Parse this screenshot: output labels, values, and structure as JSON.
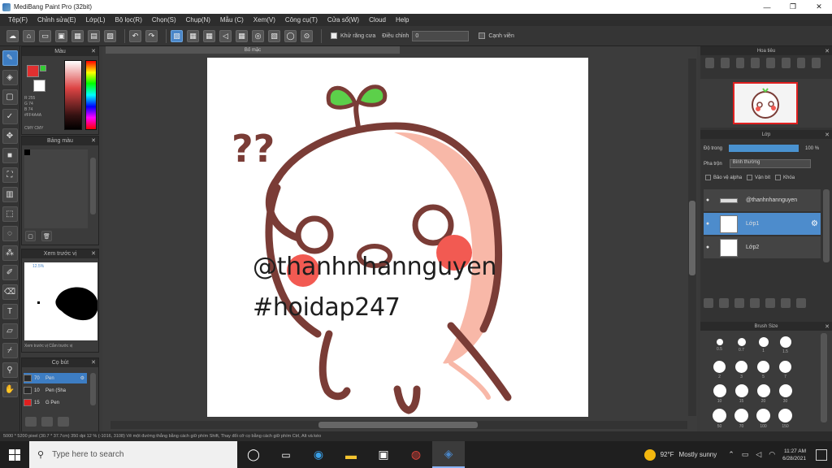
{
  "window": {
    "title": "MediBang Paint Pro (32bit)",
    "minimize": "—",
    "maximize": "❐",
    "close": "✕"
  },
  "menu": [
    "Tệp(F)",
    "Chỉnh sửa(E)",
    "Lớp(L)",
    "Bộ lọc(R)",
    "Chọn(S)",
    "Chụp(N)",
    "Mẫu (C)",
    "Xem(V)",
    "Công cụ(T)",
    "Cửa sổ(W)",
    "Cloud",
    "Help"
  ],
  "toolbar": {
    "auto_select_label": "Khử răng cưa",
    "correction_label": "Điều chỉnh",
    "correction_value": "0",
    "snap_label": "Cạnh viền"
  },
  "panels": {
    "color_title": "Màu",
    "color_info": [
      "R 255",
      "G 74",
      "B 74",
      "#FF4A4A"
    ],
    "color_footer": "CMY  CMY",
    "palette_title": "Bảng màu",
    "navigator_title": "Xem trước vị",
    "navigator_tabs": "Xem trước vị    Cắm trước vị",
    "navigator_zoom": "12.5%",
    "brush_title": "Cọ bút",
    "brushes": [
      {
        "size": "70",
        "name": "Pen",
        "color": "#2a2a2a",
        "selected": true
      },
      {
        "size": "10",
        "name": "Pen (Sha",
        "color": "#2a2a2a",
        "selected": false
      },
      {
        "size": "15",
        "name": "G Pen",
        "color": "#e02020",
        "selected": false
      }
    ]
  },
  "document_tab": "Bố mặc",
  "canvas": {
    "line1": "@thanhnhannguyen",
    "line2": "#hoidap247",
    "q_marks": "??"
  },
  "navigator": {
    "title": "Hoa tiêu"
  },
  "layers": {
    "title": "Lớp",
    "opacity_label": "Độ trong",
    "opacity_value": "100 %",
    "blend_label": "Pha trộn",
    "blend_value": "Bình thường",
    "checks": [
      "Bảo vệ alpha",
      "Vận bít",
      "Khóa"
    ],
    "items": [
      {
        "name": "@thanhnhannguyen",
        "selected": false
      },
      {
        "name": "Lớp1",
        "selected": true
      },
      {
        "name": "Lớp2",
        "selected": false
      }
    ]
  },
  "brush_size": {
    "title": "Brush Size",
    "sizes": [
      {
        "label": "0.5",
        "d": 8
      },
      {
        "label": "0.7",
        "d": 10
      },
      {
        "label": "1",
        "d": 12
      },
      {
        "label": "1.5",
        "d": 14
      },
      {
        "label": "2",
        "d": 15
      },
      {
        "label": "3",
        "d": 15
      },
      {
        "label": "5",
        "d": 15
      },
      {
        "label": "7",
        "d": 15
      },
      {
        "label": "10",
        "d": 16
      },
      {
        "label": "15",
        "d": 16
      },
      {
        "label": "20",
        "d": 16
      },
      {
        "label": "30",
        "d": 16
      },
      {
        "label": "50",
        "d": 17
      },
      {
        "label": "70",
        "d": 17
      },
      {
        "label": "100",
        "d": 17
      },
      {
        "label": "150",
        "d": 17
      }
    ]
  },
  "status": "5000 * 5200 pixel   (30.7 * 37.7cm)   350 dpi   12 %   (-1016, 3108)   Vẽ một đường thẳng bằng cách giữ phím Shift, Thay đổi cỡ cọ bằng cách giữ phím Ctrl, Alt và kéo",
  "taskbar": {
    "search_placeholder": "Type here to search",
    "weather_temp": "92°F",
    "weather_text": "Mostly sunny",
    "time": "11:27 AM",
    "date": "6/28/2021"
  },
  "colors": {
    "accent": "#4a86c8",
    "brown": "#7a3c36",
    "peach": "#f8b8a8",
    "cheek": "#f25a52",
    "sprout": "#5cd04a"
  }
}
